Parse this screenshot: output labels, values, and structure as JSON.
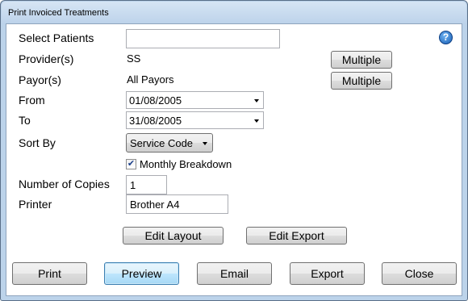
{
  "window": {
    "title": "Print Invoiced Treatments"
  },
  "form": {
    "select_patients": {
      "label": "Select Patients",
      "value": ""
    },
    "providers": {
      "label": "Provider(s)",
      "value": "SS",
      "button": "Multiple"
    },
    "payors": {
      "label": "Payor(s)",
      "value": "All Payors",
      "button": "Multiple"
    },
    "from": {
      "label": "From",
      "value": "01/08/2005"
    },
    "to": {
      "label": "To",
      "value": "31/08/2005"
    },
    "sort_by": {
      "label": "Sort By",
      "value": "Service Code"
    },
    "monthly_breakdown": {
      "label": "Monthly Breakdown",
      "checked": true,
      "check_glyph": "☑"
    },
    "copies": {
      "label": "Number of Copies",
      "value": "1"
    },
    "printer": {
      "label": "Printer",
      "value": "Brother A4"
    }
  },
  "layout_buttons": {
    "edit_layout": "Edit Layout",
    "edit_export": "Edit Export"
  },
  "footer": {
    "print": "Print",
    "preview": "Preview",
    "email": "Email",
    "export": "Export",
    "close": "Close"
  },
  "icons": {
    "help": "help-icon"
  },
  "colors": {
    "frame": "#bcd3ea",
    "accent": "#1a5fb4"
  }
}
